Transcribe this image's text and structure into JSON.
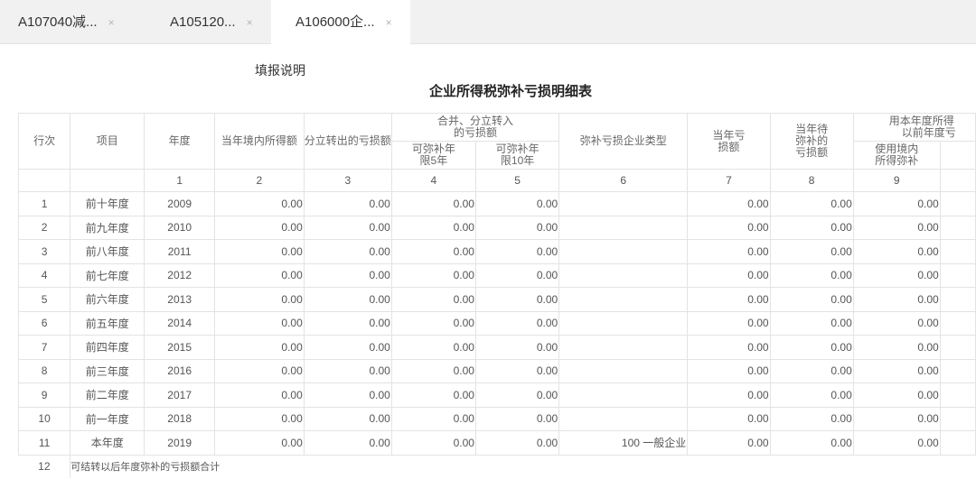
{
  "tabs": [
    {
      "label": "A107040减...",
      "active": false
    },
    {
      "label": "A105120...",
      "active": false
    },
    {
      "label": "A106000企...",
      "active": true
    }
  ],
  "close_glyph": "×",
  "instructions_link": "填报说明",
  "title": "企业所得税弥补亏损明细表",
  "header": {
    "row_no": "行次",
    "item": "项目",
    "year": "年度",
    "income": "当年境内所得额",
    "split_loss": "分立转出的亏损额",
    "merge_group_l1": "合并、分立转入",
    "merge_group_l2": "的亏损额",
    "sub5_l1": "可弥补年",
    "sub5_l2": "限5年",
    "sub10_l1": "可弥补年",
    "sub10_l2": "限10年",
    "enterprise_type": "弥补亏损企业类型",
    "current_loss_l1": "当年亏",
    "current_loss_l2": "损额",
    "pending_l1": "当年待",
    "pending_l2": "弥补的",
    "pending_l3": "亏损额",
    "use_group_l1": "用本年度所得",
    "use_group_l2": "以前年度亏",
    "domestic_l1": "使用境内",
    "domestic_l2": "所得弥补"
  },
  "column_numbers": [
    "1",
    "2",
    "3",
    "4",
    "5",
    "6",
    "7",
    "8",
    "9"
  ],
  "rows": [
    {
      "no": "1",
      "item": "前十年度",
      "year": "2009",
      "c2": "0.00",
      "c3": "0.00",
      "c4": "0.00",
      "c5": "0.00",
      "c6": "",
      "c7": "0.00",
      "c8": "0.00",
      "c9": "0.00"
    },
    {
      "no": "2",
      "item": "前九年度",
      "year": "2010",
      "c2": "0.00",
      "c3": "0.00",
      "c4": "0.00",
      "c5": "0.00",
      "c6": "",
      "c7": "0.00",
      "c8": "0.00",
      "c9": "0.00"
    },
    {
      "no": "3",
      "item": "前八年度",
      "year": "2011",
      "c2": "0.00",
      "c3": "0.00",
      "c4": "0.00",
      "c5": "0.00",
      "c6": "",
      "c7": "0.00",
      "c8": "0.00",
      "c9": "0.00"
    },
    {
      "no": "4",
      "item": "前七年度",
      "year": "2012",
      "c2": "0.00",
      "c3": "0.00",
      "c4": "0.00",
      "c5": "0.00",
      "c6": "",
      "c7": "0.00",
      "c8": "0.00",
      "c9": "0.00"
    },
    {
      "no": "5",
      "item": "前六年度",
      "year": "2013",
      "c2": "0.00",
      "c3": "0.00",
      "c4": "0.00",
      "c5": "0.00",
      "c6": "",
      "c7": "0.00",
      "c8": "0.00",
      "c9": "0.00"
    },
    {
      "no": "6",
      "item": "前五年度",
      "year": "2014",
      "c2": "0.00",
      "c3": "0.00",
      "c4": "0.00",
      "c5": "0.00",
      "c6": "",
      "c7": "0.00",
      "c8": "0.00",
      "c9": "0.00"
    },
    {
      "no": "7",
      "item": "前四年度",
      "year": "2015",
      "c2": "0.00",
      "c3": "0.00",
      "c4": "0.00",
      "c5": "0.00",
      "c6": "",
      "c7": "0.00",
      "c8": "0.00",
      "c9": "0.00"
    },
    {
      "no": "8",
      "item": "前三年度",
      "year": "2016",
      "c2": "0.00",
      "c3": "0.00",
      "c4": "0.00",
      "c5": "0.00",
      "c6": "",
      "c7": "0.00",
      "c8": "0.00",
      "c9": "0.00"
    },
    {
      "no": "9",
      "item": "前二年度",
      "year": "2017",
      "c2": "0.00",
      "c3": "0.00",
      "c4": "0.00",
      "c5": "0.00",
      "c6": "",
      "c7": "0.00",
      "c8": "0.00",
      "c9": "0.00"
    },
    {
      "no": "10",
      "item": "前一年度",
      "year": "2018",
      "c2": "0.00",
      "c3": "0.00",
      "c4": "0.00",
      "c5": "0.00",
      "c6": "",
      "c7": "0.00",
      "c8": "0.00",
      "c9": "0.00"
    },
    {
      "no": "11",
      "item": "本年度",
      "year": "2019",
      "c2": "0.00",
      "c3": "0.00",
      "c4": "0.00",
      "c5": "0.00",
      "c6": "100 一般企业",
      "c7": "0.00",
      "c8": "0.00",
      "c9": "0.00"
    }
  ],
  "last_row": {
    "no": "12",
    "label": "可结转以后年度弥补的亏损额合计"
  },
  "colors": {
    "tabbar_bg": "#f1f1f1",
    "border": "#e3e3e3",
    "text": "#555555"
  }
}
